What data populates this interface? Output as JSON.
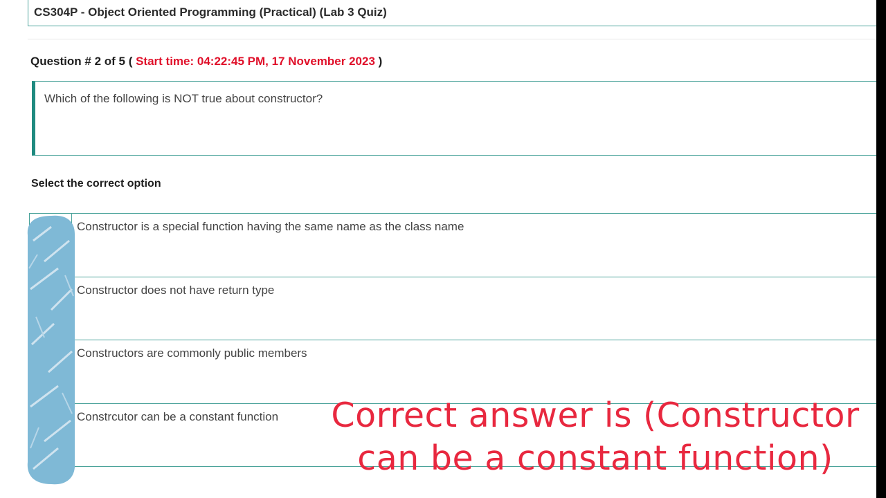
{
  "course": {
    "title": "CS304P - Object Oriented Programming (Practical) (Lab 3 Quiz)"
  },
  "question": {
    "label": "Question # 2 of 5 (",
    "start_time": "Start time: 04:22:45 PM, 17 November 2023",
    "closing": ")",
    "text": "Which of the following is NOT true about constructor?"
  },
  "options_section": {
    "label": "Select the correct option",
    "options": [
      {
        "text": "Constructor is a special function having the same name as the class name"
      },
      {
        "text": "Constructor does not have return type"
      },
      {
        "text": "Constructors are commonly public members"
      },
      {
        "text": "Constrcutor can be a constant function"
      }
    ]
  },
  "overlay": {
    "line1": "Correct answer is (Constructor",
    "line2": "can be a constant function)"
  },
  "colors": {
    "accent": "#1f8a80",
    "border": "#4aa39a",
    "start_time": "#e0102a",
    "overlay_text": "#e8283f",
    "scribble": "#7fb9d6"
  }
}
